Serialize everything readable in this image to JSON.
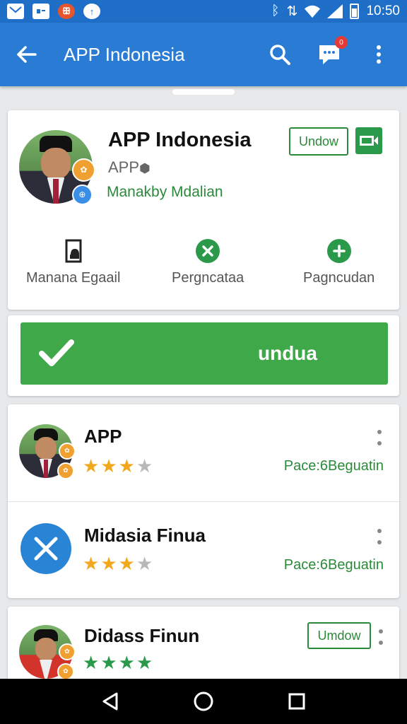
{
  "status_bar": {
    "time": "10:50",
    "icons": [
      "mail-icon",
      "contact-card-icon",
      "notification-app-icon",
      "upload-icon",
      "bluetooth-icon",
      "sync-icon",
      "wifi-icon",
      "signal-icon",
      "battery-icon"
    ]
  },
  "app_bar": {
    "title": "APP Indonesia",
    "notification_count": "0",
    "icons": [
      "back-arrow-icon",
      "search-icon",
      "chat-icon",
      "more-vert-icon"
    ]
  },
  "profile": {
    "name": "APP Indonesia",
    "subtitle": "APP",
    "subtitle_icon": "verified-icon",
    "meta": "Manakby Mdalian",
    "follow_button": "Undow",
    "video_icon": "video-icon",
    "actions": [
      {
        "label": "Manana Egaail",
        "icon": "document-icon"
      },
      {
        "label": "Pergncataa",
        "icon": "close-circle-icon"
      },
      {
        "label": "Pagncudan",
        "icon": "add-circle-icon"
      }
    ]
  },
  "primary_action": {
    "label": "undua",
    "icon": "check-icon"
  },
  "list": [
    {
      "title": "APP",
      "rating": 3,
      "max_rating": 4,
      "meta": "Pace:6Beguatin",
      "avatar": "person-avatar"
    },
    {
      "title": "Midasia Finua",
      "rating": 3,
      "max_rating": 4,
      "meta": "Pace:6Beguatin",
      "avatar": "close-icon-avatar"
    },
    {
      "title": "Didass Finun",
      "rating": 4,
      "max_rating": 4,
      "button": "Umdow",
      "avatar": "person-avatar"
    }
  ],
  "colors": {
    "app_bar": "#2a7bd3",
    "status_bar": "#1f6fc9",
    "accent_green": "#2a8a3a",
    "button_green": "#3fa848",
    "star_gold": "#f2a81d",
    "star_green": "#2a9a4a",
    "star_empty": "#b8b8b8"
  },
  "nav_bar": {
    "icons": [
      "back-triangle-icon",
      "home-circle-icon",
      "recents-square-icon"
    ]
  }
}
